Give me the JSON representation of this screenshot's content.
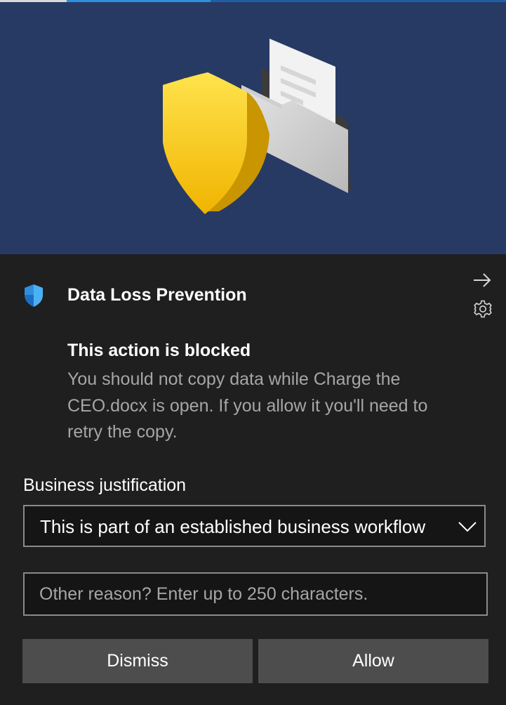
{
  "header": {
    "app_title": "Data Loss Prevention",
    "app_icon": "shield-icon",
    "open_icon": "arrow-right-icon",
    "settings_icon": "gear-icon"
  },
  "message": {
    "headline": "This action is blocked",
    "body": "You should not copy data while Charge the CEO.docx is open. If you allow it you'll need to retry the copy."
  },
  "justification": {
    "label": "Business justification",
    "selected": "This is part of an established business workflow"
  },
  "other_reason": {
    "placeholder": "Other reason? Enter up to 250 characters."
  },
  "actions": {
    "dismiss": "Dismiss",
    "allow": "Allow"
  },
  "colors": {
    "hero_background": "#273a64",
    "panel_background": "#1f1f1f",
    "button_background": "#4d4d4d",
    "shield_yellow": "#f5c518",
    "shield_blue": "#2f8fdc"
  }
}
